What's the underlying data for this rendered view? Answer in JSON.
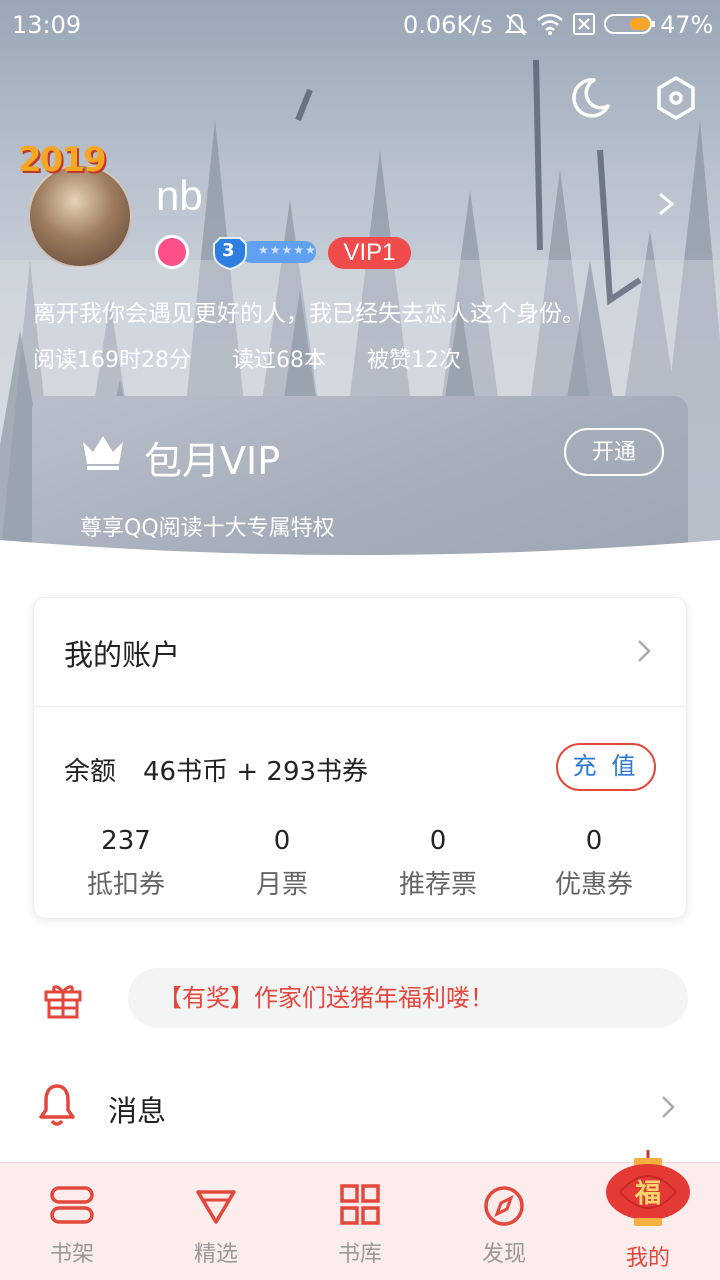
{
  "status_bar": {
    "time": "13:09",
    "network_speed": "0.06K/s",
    "battery": "47%",
    "icons": [
      "mute-icon",
      "wifi-icon",
      "sim-icon",
      "battery-icon"
    ]
  },
  "header_icons": [
    "moon-icon",
    "settings-hexagon-icon"
  ],
  "profile": {
    "badge_year": "2019",
    "username": "nb",
    "level": "3",
    "vip_level": "VIP1",
    "signature": "离开我你会遇见更好的人，我已经失去恋人这个身份。",
    "stats": {
      "reading_time": "阅读169时28分",
      "books_read": "读过68本",
      "likes": "被赞12次"
    }
  },
  "vip_card": {
    "title": "包月VIP",
    "open_label": "开通",
    "subtitle": "尊享QQ阅读十大专属特权"
  },
  "account": {
    "title": "我的账户",
    "balance_label": "余额",
    "balance_value": "46书币 + 293书券",
    "recharge_label": "充 值",
    "tickets": [
      {
        "value": "237",
        "label": "抵扣券"
      },
      {
        "value": "0",
        "label": "月票"
      },
      {
        "value": "0",
        "label": "推荐票"
      },
      {
        "value": "0",
        "label": "优惠券"
      }
    ]
  },
  "promo": {
    "text": "【有奖】作家们送猪年福利喽！"
  },
  "messages": {
    "label": "消息"
  },
  "bottom_nav": [
    {
      "label": "书架",
      "icon": "bookshelf-icon",
      "active": false
    },
    {
      "label": "精选",
      "icon": "diamond-icon",
      "active": false
    },
    {
      "label": "书库",
      "icon": "grid-icon",
      "active": false
    },
    {
      "label": "发现",
      "icon": "compass-icon",
      "active": false
    },
    {
      "label": "我的",
      "icon": "lantern-icon",
      "active": true
    }
  ],
  "colors": {
    "accent_red": "#e4473c",
    "link_blue": "#2b78d6",
    "vip_red": "#f04b4b",
    "nav_bg": "#fcecec"
  }
}
